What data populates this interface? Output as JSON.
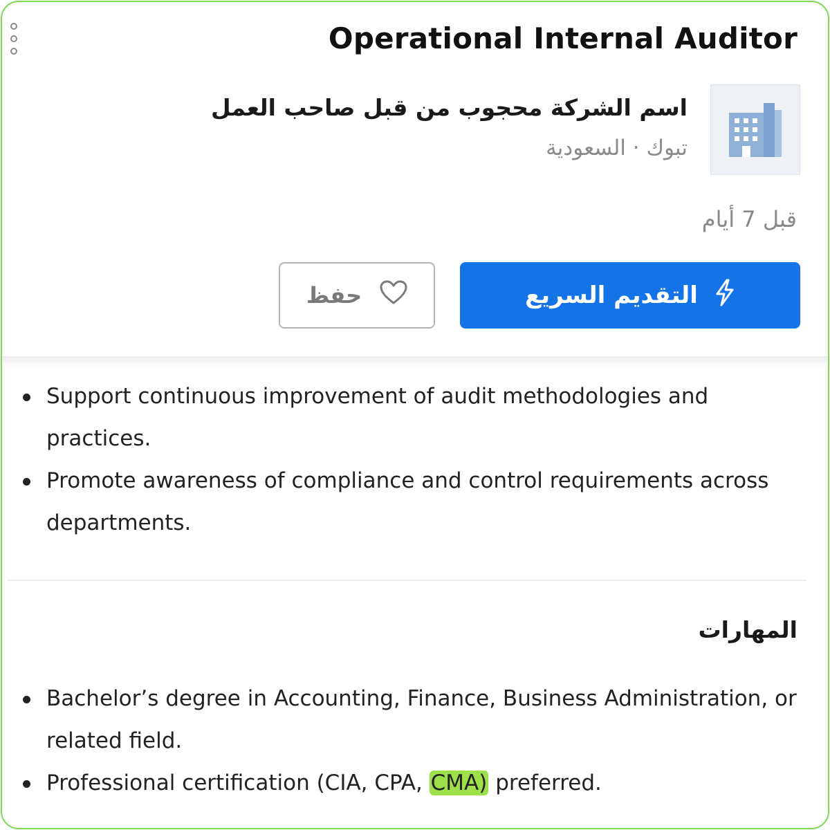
{
  "header": {
    "title": "Operational Internal Auditor",
    "company_name": "اسم الشركة محجوب من قبل صاحب العمل",
    "location": "تبوك · السعودية",
    "posted": "قبل 7 أيام",
    "logo_icon": "building-icon",
    "menu_icon": "kebab-menu-icon"
  },
  "actions": {
    "apply_label": "التقديم السريع",
    "apply_icon": "lightning-icon",
    "save_label": "حفظ",
    "save_icon": "heart-icon"
  },
  "responsibilities": [
    "Support continuous improvement of audit methodologies and practices.",
    "Promote awareness of compliance and control requirements across departments."
  ],
  "skills": {
    "heading": "المهارات",
    "items": [
      {
        "text": "Bachelor’s degree in Accounting, Finance, Business Administration, or related field."
      },
      {
        "before": "Professional certification (CIA, CPA, ",
        "highlighted": "CMA)",
        "after": " preferred."
      }
    ]
  },
  "colors": {
    "primary": "#1473e6",
    "highlight": "#9ee04a",
    "frame_border": "#7ed957",
    "muted_text": "#8a8a8a"
  }
}
